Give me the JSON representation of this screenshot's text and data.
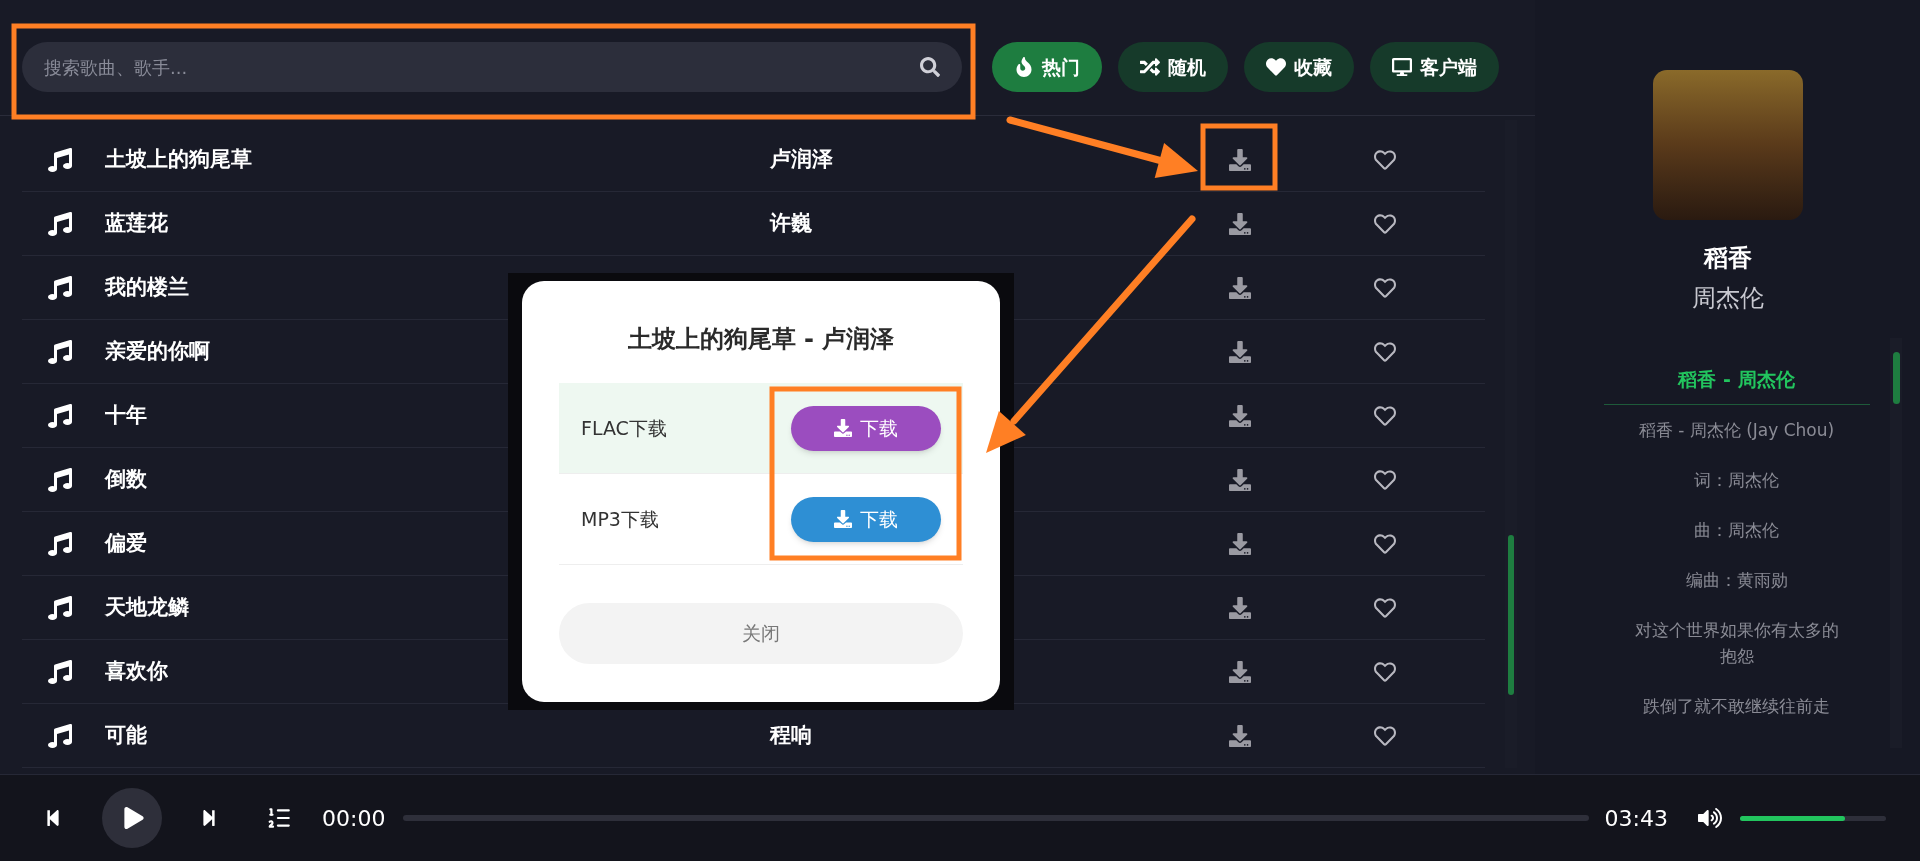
{
  "search": {
    "placeholder": "搜索歌曲、歌手..."
  },
  "nav_buttons": [
    {
      "label": "热门",
      "selected": true
    },
    {
      "label": "随机",
      "selected": false
    },
    {
      "label": "收藏",
      "selected": false
    },
    {
      "label": "客户端",
      "selected": false
    }
  ],
  "songs": [
    {
      "title": "土坡上的狗尾草",
      "artist": "卢润泽"
    },
    {
      "title": "蓝莲花",
      "artist": "许巍"
    },
    {
      "title": "我的楼兰"
    },
    {
      "title": "亲爱的你啊"
    },
    {
      "title": "十年"
    },
    {
      "title": "倒数"
    },
    {
      "title": "偏爱"
    },
    {
      "title": "天地龙鳞"
    },
    {
      "title": "喜欢你"
    },
    {
      "title": "可能",
      "artist": "程响"
    }
  ],
  "now_playing": {
    "title": "稻香",
    "artist": "周杰伦"
  },
  "lyrics": [
    {
      "text": "稻香 - 周杰伦",
      "selected": true
    },
    {
      "text": "稻香 - 周杰伦 (Jay Chou)",
      "selected": false
    },
    {
      "text": "词：周杰伦",
      "selected": false
    },
    {
      "text": "曲：周杰伦",
      "selected": false
    },
    {
      "text": "编曲：黄雨勋",
      "selected": false
    },
    {
      "text": "对这个世界如果你有太多的抱怨",
      "selected": false
    },
    {
      "text": "跌倒了就不敢继续往前走",
      "selected": false
    }
  ],
  "download_dialog": {
    "title": "土坡上的狗尾草 - 卢润泽",
    "options": [
      {
        "label": "FLAC下载",
        "button": "下载",
        "color": "#9b4dbf",
        "highlighted": true
      },
      {
        "label": "MP3下载",
        "button": "下载",
        "color": "#2e8fd4",
        "highlighted": false
      }
    ],
    "close": "关闭"
  },
  "player": {
    "current_time": "00:00",
    "duration": "03:43",
    "volume": {
      "level": 0.72
    }
  }
}
